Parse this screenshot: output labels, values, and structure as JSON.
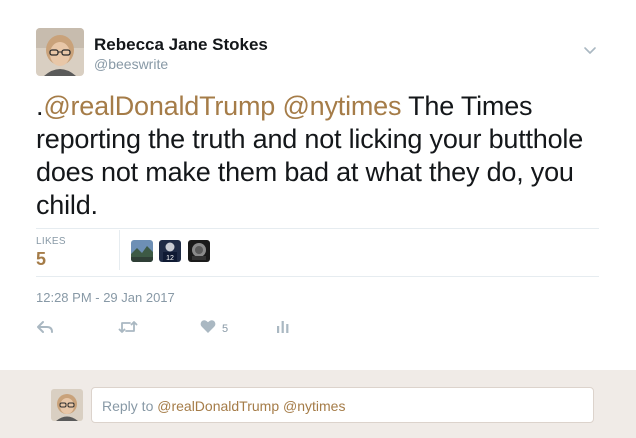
{
  "tweet": {
    "display_name": "Rebecca Jane Stokes",
    "handle": "@beeswrite",
    "text_prefix": ".",
    "mention_1": "@realDonaldTrump",
    "mention_2": "@nytimes",
    "text_body": " The Times reporting the truth and not licking your butthole does not make them bad at what they do, you child.",
    "timestamp": "12:28 PM - 29 Jan 2017"
  },
  "stats": {
    "likes_label": "LIKES",
    "likes_count": "5",
    "liker_avatars": [
      "landscape-avatar",
      "football-player-avatar",
      "dark-round-avatar"
    ]
  },
  "actions": {
    "reply_icon": "reply-icon",
    "retweet_icon": "retweet-icon",
    "like_icon": "heart-icon",
    "like_count": "5",
    "analytics_icon": "analytics-icon"
  },
  "reply": {
    "prefix": "Reply to ",
    "mention_1": "@realDonaldTrump",
    "mention_2": "@nytimes"
  },
  "colors": {
    "accent": "#a57c48",
    "muted": "#8899a6",
    "reply_bar_bg": "#f0ebe7"
  }
}
